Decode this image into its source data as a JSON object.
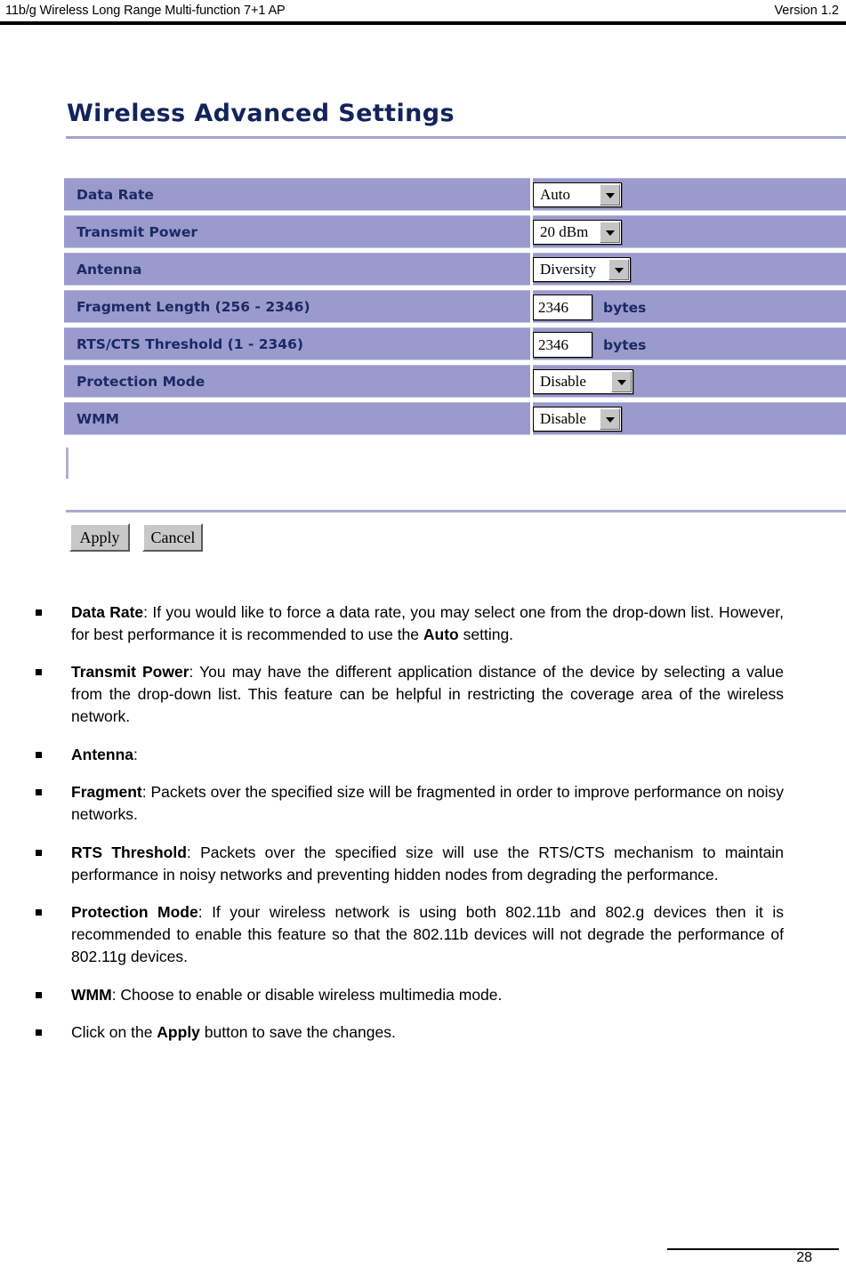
{
  "header": {
    "left_text": "11b/g Wireless Long Range Multi-function 7+1 AP",
    "right_text": "Version 1.2"
  },
  "screen": {
    "title": "Wireless Advanced Settings",
    "rows": [
      {
        "label": "Data Rate",
        "control": "select",
        "value": "Auto",
        "unit": ""
      },
      {
        "label": "Transmit Power",
        "control": "select",
        "value": "20 dBm",
        "unit": ""
      },
      {
        "label": "Antenna",
        "control": "select",
        "value": "Diversity",
        "unit": ""
      },
      {
        "label": "Fragment Length (256 - 2346)",
        "control": "text",
        "value": "2346",
        "unit": "bytes"
      },
      {
        "label": "RTS/CTS Threshold (1 - 2346)",
        "control": "text",
        "value": "2346",
        "unit": "bytes"
      },
      {
        "label": "Protection Mode",
        "control": "select",
        "value": "Disable",
        "unit": ""
      },
      {
        "label": "WMM",
        "control": "select",
        "value": "Disable",
        "unit": ""
      }
    ],
    "buttons": {
      "apply": "Apply",
      "cancel": "Cancel"
    }
  },
  "descriptions": [
    {
      "term": "Data Rate",
      "text": ": If you would like to force a data rate, you may select one from the drop-down list. However, for best performance it is recommended to use the ",
      "bold_tail": "Auto",
      "tail": " setting."
    },
    {
      "term": "Transmit Power",
      "text": ": You may have the different application distance of the device by selecting a value from the drop-down list. This feature can be helpful in restricting the coverage area of the wireless network.",
      "bold_tail": "",
      "tail": ""
    },
    {
      "term": "Antenna",
      "text": ":",
      "bold_tail": "",
      "tail": ""
    },
    {
      "term": "Fragment",
      "text": ": Packets over the specified size will be fragmented in order to improve performance on noisy networks.",
      "bold_tail": "",
      "tail": ""
    },
    {
      "term": "RTS Threshold",
      "text": ": Packets over the specified size will use the RTS/CTS mechanism to maintain performance in noisy networks and preventing hidden nodes from degrading the performance.",
      "bold_tail": "",
      "tail": ""
    },
    {
      "term": "Protection Mode",
      "text": ": If your wireless network is using both 802.11b and 802.g devices then it is recommended to enable this feature so that the 802.11b devices will not degrade the performance of 802.11g devices.",
      "bold_tail": "",
      "tail": ""
    },
    {
      "term": "WMM",
      "text": ": Choose to enable or disable wireless multimedia mode.",
      "bold_tail": "",
      "tail": ""
    },
    {
      "term": "",
      "text": "Click on the ",
      "bold_tail": "Apply",
      "tail": " button to save the changes."
    }
  ],
  "footer": {
    "page_number": "28"
  },
  "colors": {
    "row_background": "#9a9acd",
    "label_text": "#1b2a63",
    "title_text": "#13235b",
    "rule": "#a3a3cf"
  }
}
